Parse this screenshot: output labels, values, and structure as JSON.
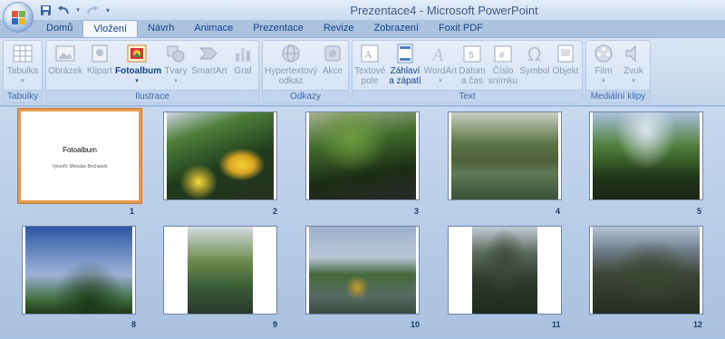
{
  "window": {
    "title": "Prezentace4 - Microsoft PowerPoint"
  },
  "tabs": [
    {
      "label": "Domů"
    },
    {
      "label": "Vložení",
      "active": true
    },
    {
      "label": "Návrh"
    },
    {
      "label": "Animace"
    },
    {
      "label": "Prezentace"
    },
    {
      "label": "Revize"
    },
    {
      "label": "Zobrazení"
    },
    {
      "label": "Foxit PDF"
    }
  ],
  "ribbon": {
    "groups": {
      "tabulky": "Tabulky",
      "ilustrace": "Ilustrace",
      "odkazy": "Odkazy",
      "text": "Text",
      "media": "Mediální klipy"
    },
    "buttons": {
      "tabulka": "Tabulka",
      "obrazek": "Obrázek",
      "klipart": "Klipart",
      "fotoalbum": "Fotoalbum",
      "tvary": "Tvary",
      "smartart": "SmartArt",
      "graf": "Graf",
      "hypertext_1": "Hypertextový",
      "hypertext_2": "odkaz",
      "akce": "Akce",
      "textove_1": "Textové",
      "textove_2": "pole",
      "zahlavi_1": "Záhlaví",
      "zahlavi_2": "a zápatí",
      "wordart": "WordArt",
      "datum_1": "Datum",
      "datum_2": "a čas",
      "cislo_1": "Číslo",
      "cislo_2": "snímku",
      "symbol": "Symbol",
      "objekt": "Objekt",
      "film": "Film",
      "zvuk": "Zvuk"
    }
  },
  "slides": [
    {
      "num": "1",
      "title": "Fotoalbum",
      "subtitle": "Vytvořil: Miroslav Brichacek"
    },
    {
      "num": "2"
    },
    {
      "num": "3"
    },
    {
      "num": "4"
    },
    {
      "num": "5"
    },
    {
      "num": "8"
    },
    {
      "num": "9"
    },
    {
      "num": "10"
    },
    {
      "num": "11"
    },
    {
      "num": "12"
    }
  ],
  "colors": {
    "accent": "#e69b4e",
    "ribbon": "#dbe6f4",
    "text": "#15428b"
  }
}
